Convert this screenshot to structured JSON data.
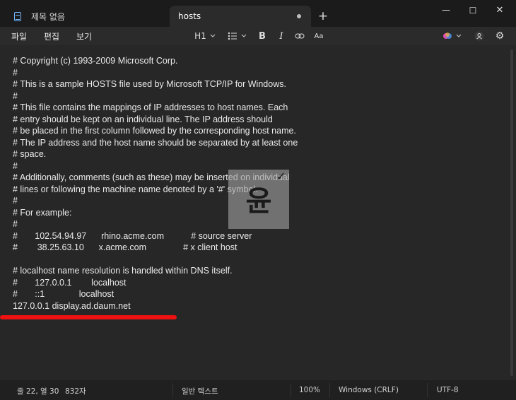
{
  "tabs": [
    {
      "label": "제목 없음"
    },
    {
      "label": "hosts"
    }
  ],
  "window_controls": {
    "minimize": "—",
    "maximize": "☐",
    "close": "✕",
    "new_tab": "+"
  },
  "menu": {
    "file": "파일",
    "edit": "편집",
    "view": "보기"
  },
  "toolbar": {
    "heading": "H1",
    "bold": "B",
    "italic": "I",
    "spell": "Aa"
  },
  "document": {
    "lines": [
      "# Copyright (c) 1993-2009 Microsoft Corp.",
      "#",
      "# This is a sample HOSTS file used by Microsoft TCP/IP for Windows.",
      "#",
      "# This file contains the mappings of IP addresses to host names. Each",
      "# entry should be kept on an individual line. The IP address should",
      "# be placed in the first column followed by the corresponding host name.",
      "# The IP address and the host name should be separated by at least one",
      "# space.",
      "#",
      "# Additionally, comments (such as these) may be inserted on individual",
      "# lines or following the machine name denoted by a '#' symbol.",
      "#",
      "# For example:",
      "#",
      "#       102.54.94.97      rhino.acme.com           # source server",
      "#        38.25.63.10      x.acme.com               # x client host",
      "",
      "# localhost name resolution is handled within DNS itself.",
      "#       127.0.0.1        localhost",
      "#       ::1              localhost",
      "127.0.0.1 display.ad.daum.net"
    ]
  },
  "watermark": {
    "glyph": "윤",
    "mark": "✓"
  },
  "status": {
    "position": "줄 22, 열 30",
    "chars": "832자",
    "format": "일반 텍스트",
    "zoom": "100%",
    "line_ending": "Windows (CRLF)",
    "encoding": "UTF-8"
  },
  "colors": {
    "accent_red": "#ee1111",
    "tab_icon": "#6fb6ff"
  }
}
